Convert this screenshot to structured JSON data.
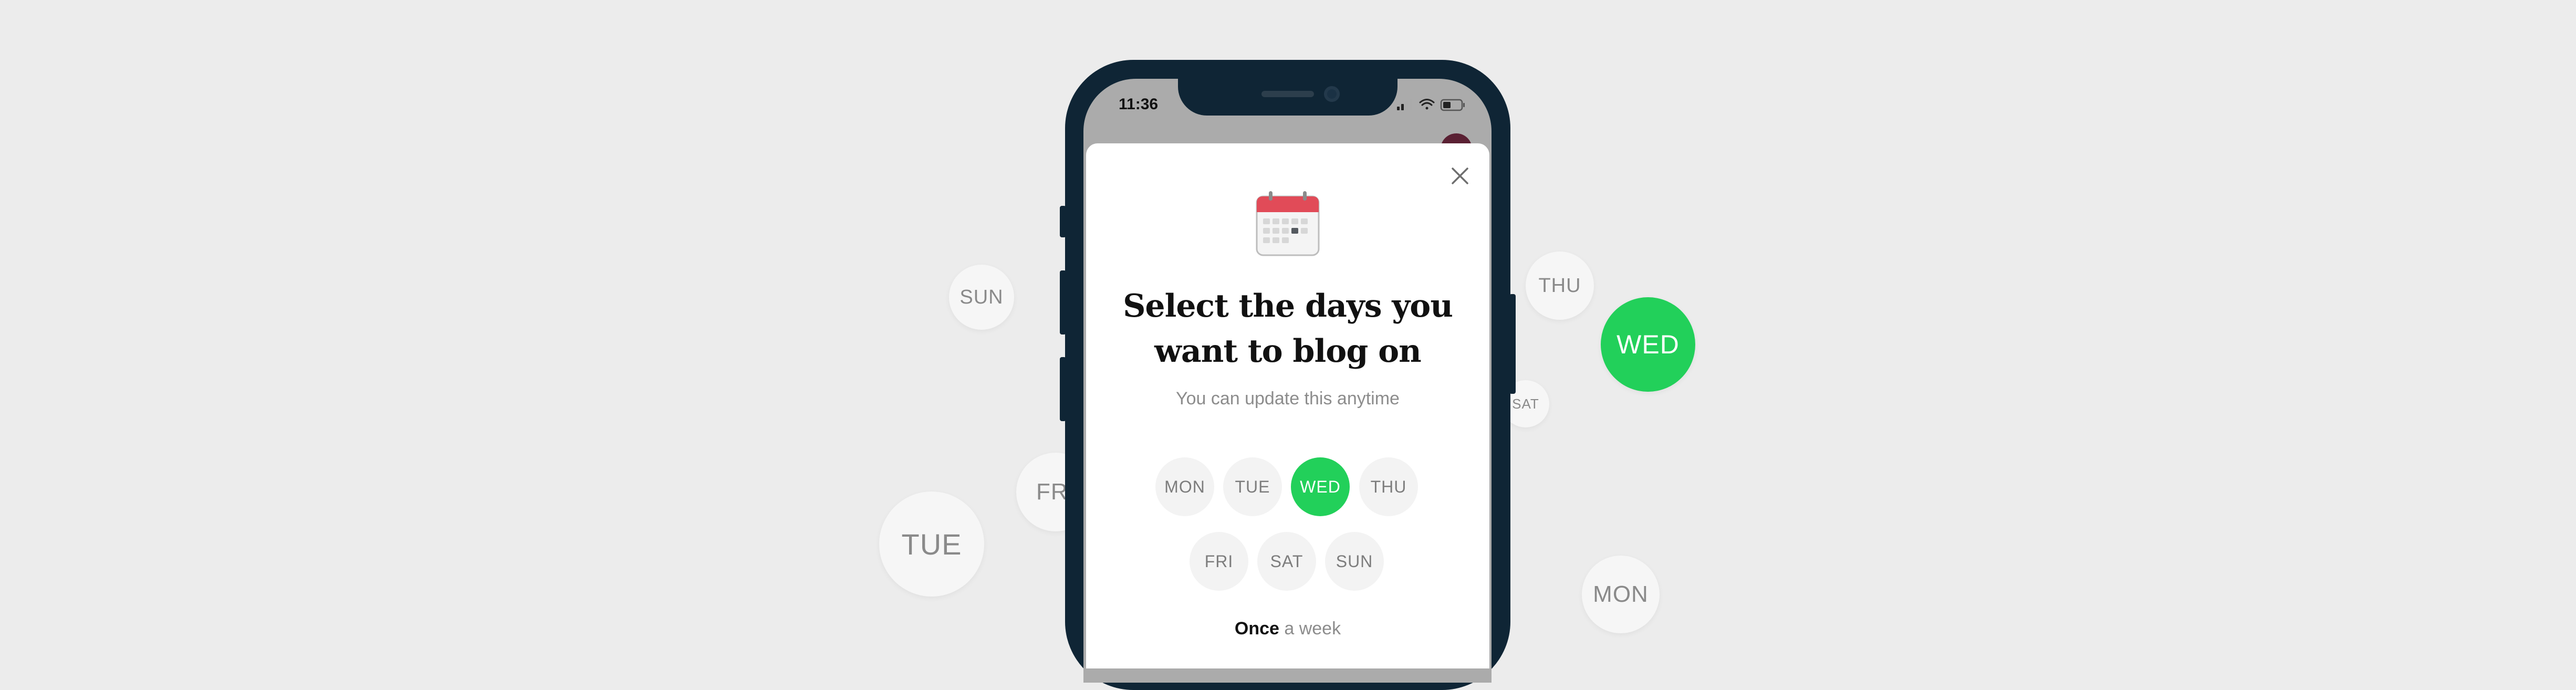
{
  "background_bubbles": {
    "sun": "SUN",
    "thu": "THU",
    "wed": "WED",
    "sat": "SAT",
    "fri": "FRI",
    "tue": "TUE",
    "mon": "MON"
  },
  "status_bar": {
    "time": "11:36"
  },
  "modal": {
    "title_line1": "Select the days you",
    "title_line2": "want to blog on",
    "subtitle": "You can update this anytime",
    "days": [
      {
        "label": "MON",
        "selected": false
      },
      {
        "label": "TUE",
        "selected": false
      },
      {
        "label": "WED",
        "selected": true
      },
      {
        "label": "THU",
        "selected": false
      },
      {
        "label": "FRI",
        "selected": false
      },
      {
        "label": "SAT",
        "selected": false
      },
      {
        "label": "SUN",
        "selected": false
      }
    ],
    "frequency_strong": "Once",
    "frequency_rest": " a week"
  },
  "icons": {
    "close": "close-icon",
    "calendar": "calendar-icon",
    "signal": "signal-icon",
    "wifi": "wifi-icon",
    "battery": "battery-icon"
  },
  "colors": {
    "accent_green": "#22d05a",
    "background": "#ececec",
    "phone_frame": "#0f2535"
  }
}
